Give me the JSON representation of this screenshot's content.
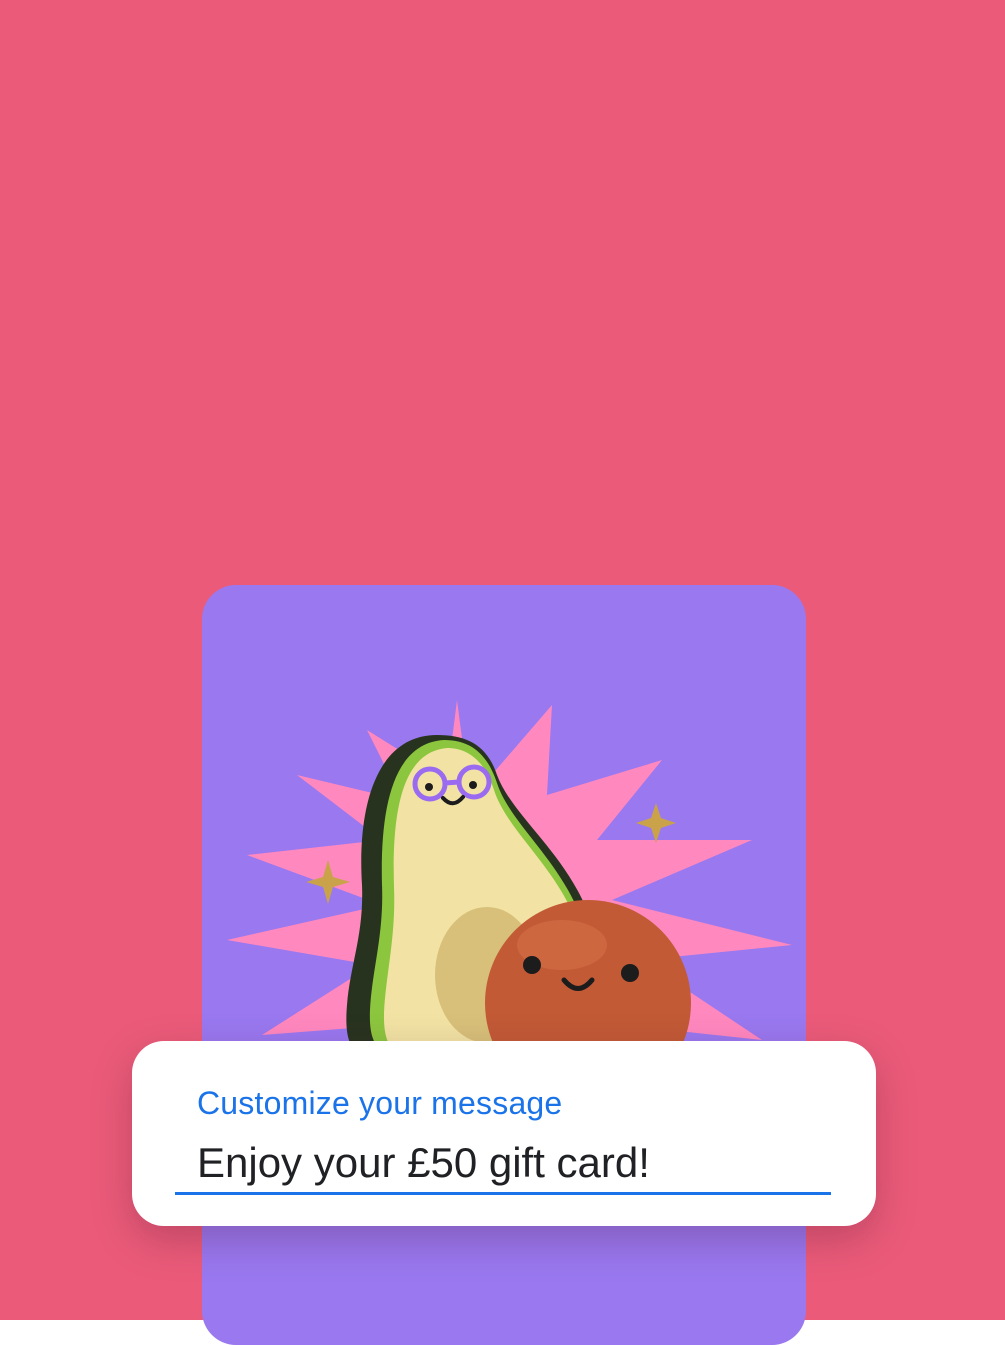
{
  "colors": {
    "background": "#eb5b79",
    "card": "#9978f0",
    "burst": "#ff88bf",
    "accent_blue": "#1a73e8"
  },
  "gift_card": {
    "illustration": "avocado-and-pit-characters-with-sparkles"
  },
  "message": {
    "label": "Customize your message",
    "value": "Enjoy your £50 gift card!"
  }
}
